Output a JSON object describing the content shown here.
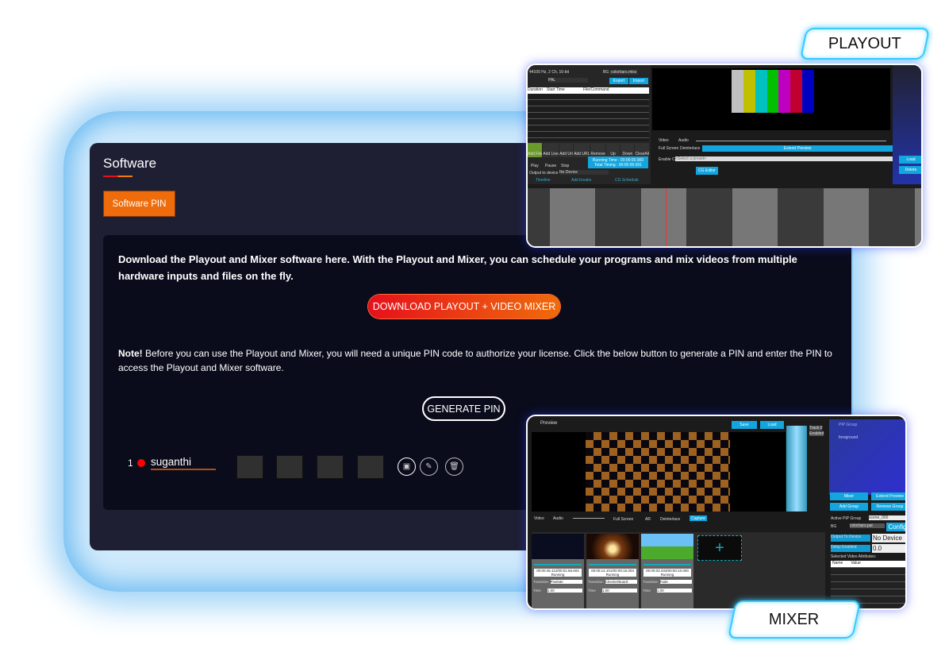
{
  "page": {
    "title": "Software",
    "pin_tab_label": "Software PIN"
  },
  "intro": "Download the Playout and Mixer software here. With the Playout and Mixer, you can schedule your programs and mix videos from multiple hardware inputs and files on the fly.",
  "download_label": "DOWNLOAD PLAYOUT + VIDEO MIXER",
  "note": {
    "prefix": "Note!",
    "text": " Before you can use the Playout and Mixer, you will need a unique PIN code to authorize your license. Click the below button to generate a PIN and enter the PIN to access the Playout and Mixer software."
  },
  "generate_label": "GENERATE PIN",
  "pin_row": {
    "index": "1",
    "status_color": "#ff0000",
    "name": "suganthi",
    "pin_boxes": [
      "",
      "",
      "",
      ""
    ],
    "actions": [
      "save-icon",
      "edit-icon",
      "delete-icon"
    ]
  },
  "playout": {
    "tag": "PLAYOUT",
    "audio_quality": "44100 Hz, 2 Ch, 16-bit",
    "bg_label": "BG",
    "bg_value": "colorbars.mlsx",
    "video_quality": "PAL",
    "export": "Export",
    "import": "Import",
    "columns": [
      "Duration",
      "Start Time",
      "File/Command"
    ],
    "toolbar": [
      "Add File",
      "Add Live",
      "Add Url",
      "Add URL",
      "Remove",
      "Up",
      "Down",
      "ClearAll"
    ],
    "transport": [
      "Play",
      "Pause",
      "Stop"
    ],
    "running_time": "Running Time : 00:00:00.000",
    "total_timing": "Total Timing : 00:00:00.001",
    "output_label": "Output to device",
    "output_value": "No Device",
    "tabs": [
      "Timeline",
      "Add breaks",
      "CG Schedule"
    ],
    "video": "Video",
    "audio": "Audio",
    "fullscreen": "Full Screen",
    "deinterlace": "Deinterlace",
    "extend_preview": "Extend Preview",
    "enable_cg": "Enable CG",
    "preset_placeholder": "<Select a preset>",
    "cg_editor": "CG Editor",
    "load": "Load",
    "delete": "Delete",
    "colorbars": [
      "#c0c0c0",
      "#c0c000",
      "#00c0c0",
      "#00c000",
      "#c000c0",
      "#c00030",
      "#0000c0"
    ]
  },
  "mixer": {
    "tag": "MIXER",
    "preview": "Preview",
    "save": "Save",
    "load": "Load",
    "pip_group": "PIP Group",
    "foreground": "foreground",
    "buttons": [
      "Mixer",
      "Extend Preview",
      "Add Group",
      "Remove Group"
    ],
    "controls": [
      "Video",
      "Audio",
      "Full Screen",
      "AR",
      "Deinterlace"
    ],
    "capture": "Capture",
    "active_pip_label": "Active PIP Group",
    "active_pip_value": "scene_000",
    "bg_label": "BG",
    "bg_value": "colorbars.pal",
    "config": "Config",
    "output_to_device": "Output To Device",
    "output_value": "No Device",
    "delay_enabled": "Delay Enabled",
    "delay_value": "0.0",
    "attributes_title": "Selected Video Attributes:",
    "attr_columns": [
      "Name",
      "Value"
    ],
    "track": "Track 0",
    "enabled": "Enabled",
    "clips": [
      {
        "time": "00:00:45.112/00:01:56.603",
        "status": "Running",
        "transition": "Pixelate",
        "duration": "1.00"
      },
      {
        "time": "00:00:14.101/00:00:15.003",
        "status": "Running",
        "transition": "CheckerBoard",
        "duration": "1.00"
      },
      {
        "time": "00:00:03.333/00:00:10.000",
        "status": "Running",
        "transition": "Fade",
        "duration": "1.00"
      }
    ],
    "transition_label": "Transition",
    "time_label": "Time"
  }
}
